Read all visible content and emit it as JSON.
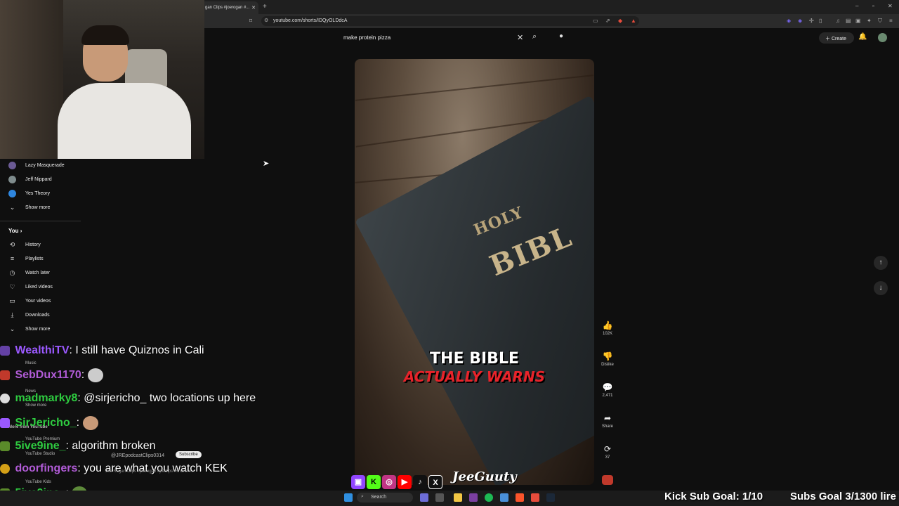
{
  "browser": {
    "tab_title": "gan Clips #joerogan #...",
    "url": "youtube.com/shorts/IDQyOLDdcA"
  },
  "header": {
    "search_value": "make protein pizza",
    "create_label": "Create"
  },
  "sidebar": {
    "subscriptions": [
      {
        "label": "Lazy Masquerade",
        "color": "#6b5b95"
      },
      {
        "label": "Jeff Nippard",
        "color": "#7f8c8d"
      },
      {
        "label": "Yes Theory",
        "color": "#2e86de"
      }
    ],
    "show_more_1": "Show more",
    "you_label": "You",
    "you_items": [
      {
        "label": "History",
        "icon": "history-icon",
        "glyph": "⟲"
      },
      {
        "label": "Playlists",
        "icon": "playlists-icon",
        "glyph": "≡"
      },
      {
        "label": "Watch later",
        "icon": "watch-later-icon",
        "glyph": "◷"
      },
      {
        "label": "Liked videos",
        "icon": "like-icon",
        "glyph": "👍"
      },
      {
        "label": "Your videos",
        "icon": "your-videos-icon",
        "glyph": "▭"
      },
      {
        "label": "Downloads",
        "icon": "download-icon",
        "glyph": "⤓"
      }
    ],
    "show_more_2": "Show more",
    "ghost_items": [
      "Music",
      "News",
      "Show more",
      "More from YouTube",
      "YouTube Premium",
      "YouTube Studio",
      "YouTube Kids"
    ]
  },
  "short": {
    "caption_line1": "THE BIBLE",
    "caption_line2": "ACTUALLY WARNS",
    "book_title_top": "HOLY",
    "book_title_main": "BIBL"
  },
  "actions": {
    "like_count": "102K",
    "dislike_label": "Dislike",
    "comments_count": "2,471",
    "share_label": "Share",
    "remix_count": "37"
  },
  "chat": [
    {
      "user": "WealthiTV",
      "color": "#9b59ff",
      "msg": ": I still have Quiznos in Cali"
    },
    {
      "user": "SebDux1170",
      "color": "#b05bd6",
      "msg": ": "
    },
    {
      "user": "madmarky8",
      "color": "#2ecc40",
      "msg": ": @sirjericho_ two locations up here"
    },
    {
      "user": "SirJericho_",
      "color": "#2ecc40",
      "msg": ": "
    },
    {
      "user": "5ive9ine_",
      "color": "#2ecc40",
      "msg": ": algorithm broken"
    },
    {
      "user": "doorfingers",
      "color": "#b05bd6",
      "msg": ": you are what you watch KEK"
    },
    {
      "user": "5ive9ine_",
      "color": "#2ecc40",
      "msg": ": "
    }
  ],
  "ghost_channel": "@JREpodcastClips0314",
  "ghost_subscribe": "Subscribe",
  "ghost_video_title": "Joe Rogan Clips #joerogan #jreclips #shorts #...",
  "brand": "JeeGuuty",
  "taskbar": {
    "search_label": "Search"
  },
  "overlay": {
    "kick_goal": "Kick Sub Goal: 1/10",
    "subs_goal": "Subs Goal 3/1300 lire"
  }
}
